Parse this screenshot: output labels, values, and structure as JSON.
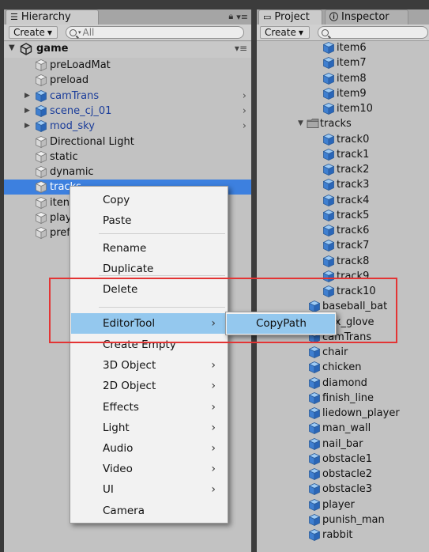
{
  "hierarchy": {
    "tab_label": "Hierarchy",
    "create_label": "Create",
    "search_placeholder": "All",
    "scene_name": "game",
    "items": [
      {
        "label": "preLoadMat",
        "icon": "gameobject-gray-icon",
        "prefab": false,
        "expandable": false
      },
      {
        "label": "preload",
        "icon": "gameobject-gray-icon",
        "prefab": false,
        "expandable": false
      },
      {
        "label": "camTrans",
        "icon": "prefab-blue-icon",
        "prefab": true,
        "expandable": true
      },
      {
        "label": "scene_cj_01",
        "icon": "prefab-blue-icon",
        "prefab": true,
        "expandable": true
      },
      {
        "label": "mod_sky",
        "icon": "prefab-blue-icon",
        "prefab": true,
        "expandable": true
      },
      {
        "label": "Directional Light",
        "icon": "gameobject-gray-icon",
        "prefab": false,
        "expandable": false
      },
      {
        "label": "static",
        "icon": "gameobject-gray-icon",
        "prefab": false,
        "expandable": false
      },
      {
        "label": "dynamic",
        "icon": "gameobject-gray-icon",
        "prefab": false,
        "expandable": false
      },
      {
        "label": "tracks",
        "icon": "gameobject-gray-icon",
        "prefab": false,
        "expandable": false,
        "selected": true
      },
      {
        "label": "iten",
        "icon": "gameobject-gray-icon",
        "prefab": false,
        "expandable": false
      },
      {
        "label": "play",
        "icon": "gameobject-gray-icon",
        "prefab": false,
        "expandable": false
      },
      {
        "label": "pref",
        "icon": "gameobject-gray-icon",
        "prefab": false,
        "expandable": false
      }
    ]
  },
  "project": {
    "tab_label": "Project",
    "inspector_tab_label": "Inspector",
    "create_label": "Create",
    "folder_label": "tracks",
    "items_above": [
      "item6",
      "item7",
      "item8",
      "item9",
      "item10"
    ],
    "tracks": [
      "track0",
      "track1",
      "track2",
      "track3",
      "track4",
      "track5",
      "track6",
      "track7",
      "track8",
      "track9",
      "track10"
    ],
    "root_items": [
      "baseball_bat",
      "box_glove",
      "camTrans",
      "chair",
      "chicken",
      "diamond",
      "finish_line",
      "liedown_player",
      "man_wall",
      "nail_bar",
      "obstacle1",
      "obstacle2",
      "obstacle3",
      "player",
      "punish_man",
      "rabbit"
    ]
  },
  "context_menu": {
    "items": [
      {
        "label": "Copy",
        "submenu": false
      },
      {
        "label": "Paste",
        "submenu": false
      },
      {
        "label": "Rename",
        "submenu": false
      },
      {
        "label": "Duplicate",
        "submenu": false
      },
      {
        "label": "Delete",
        "submenu": false
      },
      {
        "label": "EditorTool",
        "submenu": true,
        "highlighted": true
      },
      {
        "label": "Create Empty",
        "submenu": false
      },
      {
        "label": "3D Object",
        "submenu": true
      },
      {
        "label": "2D Object",
        "submenu": true
      },
      {
        "label": "Effects",
        "submenu": true
      },
      {
        "label": "Light",
        "submenu": true
      },
      {
        "label": "Audio",
        "submenu": true
      },
      {
        "label": "Video",
        "submenu": true
      },
      {
        "label": "UI",
        "submenu": true
      },
      {
        "label": "Camera",
        "submenu": false
      }
    ],
    "submenu_item": "CopyPath"
  },
  "colors": {
    "selection": "#3d80df",
    "menu_highlight": "#94c8ee",
    "annotation_box": "#e33434",
    "prefab_text": "#1a3c9a"
  }
}
